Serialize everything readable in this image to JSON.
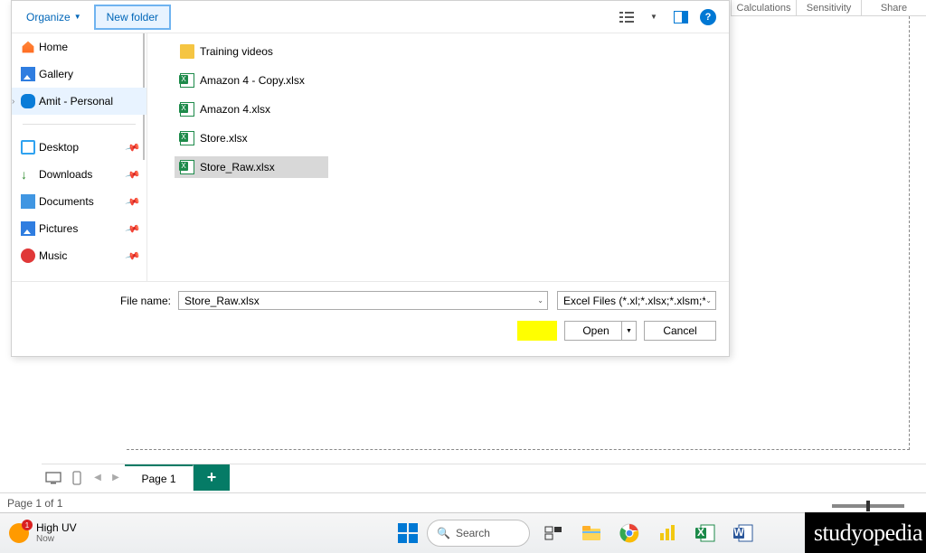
{
  "topCmds": [
    "Calculations",
    "Sensitivity",
    "Share"
  ],
  "dialog": {
    "organize": "Organize",
    "newFolder": "New folder",
    "nav": {
      "home": "Home",
      "gallery": "Gallery",
      "cloud": "Amit - Personal",
      "desktop": "Desktop",
      "downloads": "Downloads",
      "documents": "Documents",
      "pictures": "Pictures",
      "music": "Music"
    },
    "files": {
      "folder1": "Training videos",
      "f1": "Amazon 4 - Copy.xlsx",
      "f2": "Amazon 4.xlsx",
      "f3": "Store.xlsx",
      "f4": "Store_Raw.xlsx"
    },
    "fnLabel": "File name:",
    "fnValue": "Store_Raw.xlsx",
    "ftValue": "Excel Files (*.xl;*.xlsx;*.xlsm;*.xl",
    "open": "Open",
    "cancel": "Cancel"
  },
  "pageTab": "Page 1",
  "status": "Page 1 of 1",
  "weather": {
    "title": "High UV",
    "sub": "Now"
  },
  "search": "Search",
  "brand": "studyopedia"
}
